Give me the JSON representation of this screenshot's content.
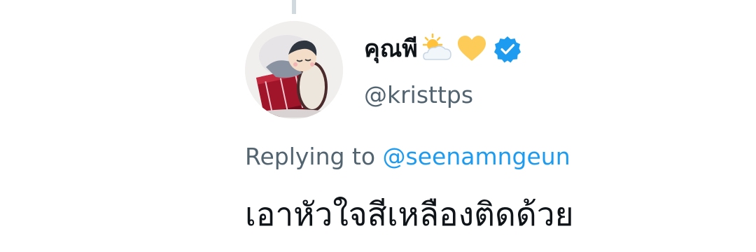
{
  "user": {
    "display_name": "คุณพี",
    "name_emojis": [
      "sun-behind-cloud-emoji",
      "yellow-heart-emoji"
    ],
    "verified": true,
    "handle": "@kristtps"
  },
  "reply": {
    "prefix": "Replying to",
    "target": "@seenamngeun"
  },
  "tweet": {
    "text": "เอาหัวใจสีเหลืองติดด้วย"
  },
  "colors": {
    "verified": "#1d9bf0",
    "link": "#1d9bf0",
    "secondary_text": "#536471",
    "primary_text": "#0f1419",
    "thread_line": "#cfd9de"
  }
}
